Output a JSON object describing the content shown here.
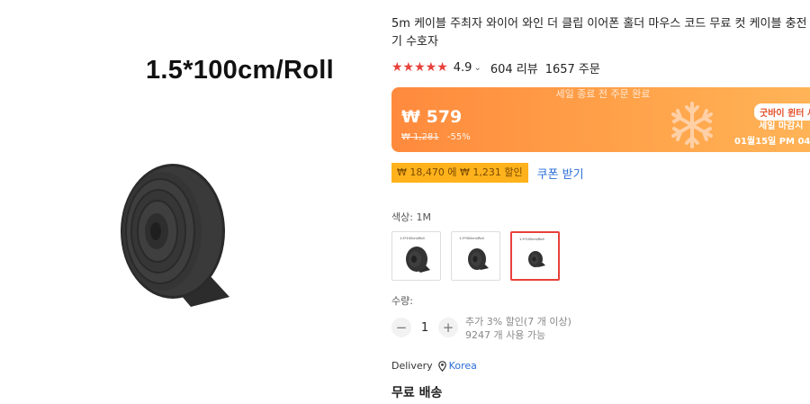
{
  "image": {
    "caption": "1.5*100cm/Roll"
  },
  "product": {
    "title": "5m 케이블 주최자 와이어 와인 더 클립 이어폰 홀더 마우스 코드 무료 컷 케이블 충전기 수호자",
    "stars": "★★★★★",
    "rating": "4.9",
    "reviews": "604 리뷰",
    "orders": "1657 주문"
  },
  "sale": {
    "top_text": "세일 종료 전 주문 완료",
    "price": "₩ 579",
    "original_price": "₩ 1,281",
    "discount": "-55%",
    "badge": "굿바이 윈터 세",
    "deadline_label": "세일 마감시",
    "deadline_date": "01월15일 PM 04",
    "colors": {
      "start": "#ff8a3d",
      "end": "#ffb457"
    }
  },
  "coupon": {
    "tag": "₩ 18,470 에 ₩ 1,231 할인",
    "link": "쿠폰 받기"
  },
  "color": {
    "label": "색상: 1M",
    "options": [
      {
        "mini_label": "1.5*100cm/Roll",
        "selected": false
      },
      {
        "mini_label": "1.5*300cm/Roll",
        "selected": false
      },
      {
        "mini_label": "1.5*100cm/Roll",
        "selected": true
      }
    ]
  },
  "quantity": {
    "label": "수량:",
    "minus": "−",
    "value": "1",
    "plus": "+",
    "extra_discount": "추가 3% 할인(7 개 이상)",
    "available": "9247 개 사용 가능"
  },
  "delivery": {
    "label": "Delivery",
    "place": "Korea",
    "shipping": "무료 배송"
  }
}
